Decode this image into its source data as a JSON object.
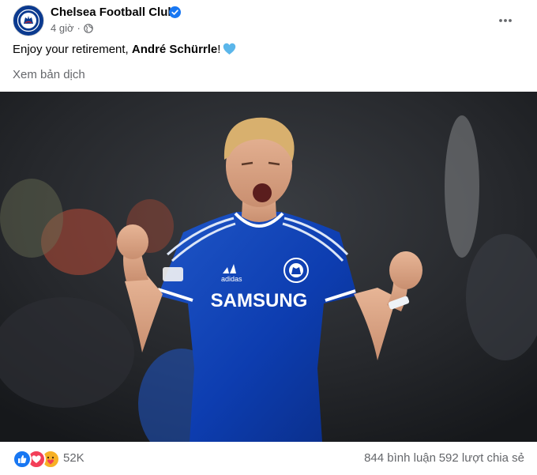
{
  "post": {
    "page_name": "Chelsea Football Club",
    "verified_icon": "verified-badge-icon",
    "time": "4 giờ",
    "separator": "·",
    "audience_icon": "globe-icon",
    "more_icon": "more-options-icon",
    "text_before": "Enjoy your retirement, ",
    "mention": "André Schürrle",
    "text_after": "!",
    "emoji": "blue-heart-icon",
    "translate_link": "Xem bản dịch"
  },
  "photo": {
    "jersey_sponsor": "SAMSUNG",
    "jersey_brand": "adidas"
  },
  "footer": {
    "reaction_icons": [
      "like-icon",
      "love-icon",
      "care-icon"
    ],
    "reaction_count": "52K",
    "comments": "844 bình luận",
    "shares": "592 lượt chia sẻ"
  },
  "colors": {
    "brand_blue": "#0b3a8f",
    "verified_blue": "#1877f2",
    "secondary_text": "#65676b",
    "heart_blue": "#5bb6ea"
  }
}
